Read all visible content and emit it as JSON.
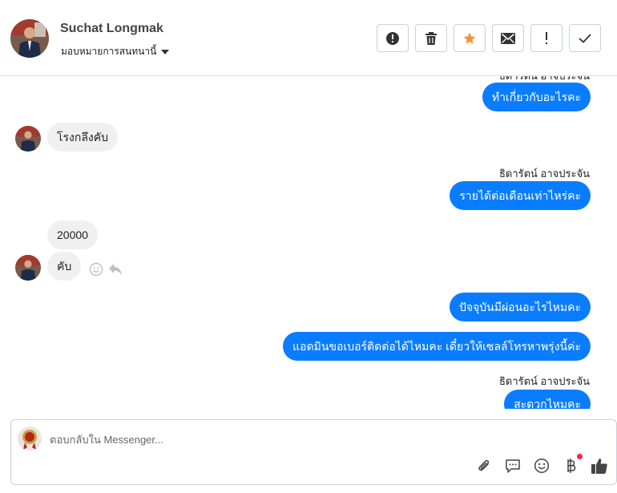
{
  "header": {
    "contact_name": "Suchat Longmak",
    "assign_label": "มอบหมายการสนทนานี้",
    "actions": [
      {
        "name": "spam-button",
        "icon": "alert-circle-icon"
      },
      {
        "name": "delete-button",
        "icon": "trash-icon"
      },
      {
        "name": "star-button",
        "icon": "star-icon",
        "color": "#f7923b"
      },
      {
        "name": "mark-unread-button",
        "icon": "envelope-icon"
      },
      {
        "name": "follow-up-button",
        "icon": "exclamation-icon"
      },
      {
        "name": "mark-done-button",
        "icon": "check-icon"
      }
    ]
  },
  "thread": {
    "clipped_sender_top": "ธิดารัตน์ อาจประจัน",
    "messages": {
      "m1": "ทำเกี่ยวกับอะไรคะ",
      "m2": "โรงกลึงคับ",
      "sender_1": "ธิดารัตน์ อาจประจัน",
      "m3": "รายได้ต่อเดือนเท่าไหร่คะ",
      "m4": "20000",
      "m5": "คับ",
      "m6": "ปัจจุบันมีผ่อนอะไรไหมคะ",
      "m7": "แอดมินขอเบอร์ติดต่อได้ไหมคะ เดี๋ยวให้เซลล์โทรหาพรุ่งนี้ค่ะ",
      "sender_2": "ธิดารัตน์ อาจประจัน",
      "m8": "สะดวกไหมคะ"
    }
  },
  "composer": {
    "placeholder": "ตอบกลับใน Messenger...",
    "tools": [
      "attachment-icon",
      "saved-reply-icon",
      "emoji-icon",
      "payment-icon",
      "thumbs-up-icon"
    ]
  },
  "colors": {
    "outgoing_bubble": "#0a7cff",
    "incoming_bubble": "#f0f0f0",
    "star": "#f7923b",
    "notification_dot": "#f02849"
  }
}
